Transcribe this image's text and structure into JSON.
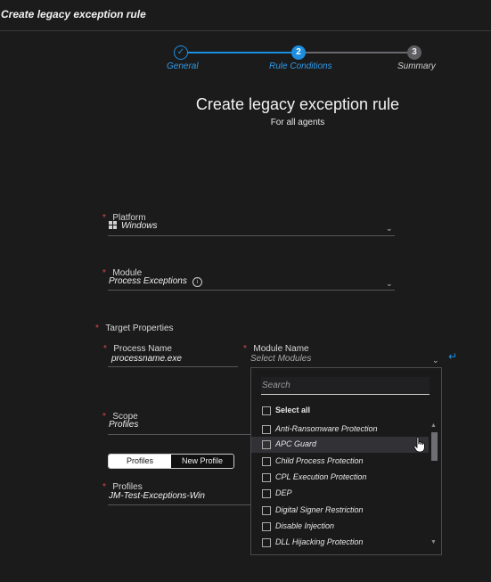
{
  "header": {
    "title": "Create legacy exception rule"
  },
  "stepper": {
    "steps": [
      {
        "number": "✓",
        "label": "General",
        "state": "done"
      },
      {
        "number": "2",
        "label": "Rule Conditions",
        "state": "active"
      },
      {
        "number": "3",
        "label": "Summary",
        "state": "pending"
      }
    ]
  },
  "page": {
    "title": "Create legacy exception rule",
    "subtitle": "For all agents"
  },
  "form": {
    "required_mark": "*",
    "platform": {
      "label": "Platform",
      "value": "Windows"
    },
    "module": {
      "label": "Module",
      "value": "Process Exceptions",
      "info_icon": "info-icon"
    },
    "target_properties": {
      "label": "Target Properties"
    },
    "process_name": {
      "label": "Process Name",
      "value": "processname.exe"
    },
    "module_name": {
      "label": "Module Name",
      "placeholder": "Select Modules",
      "enter_icon": "↵"
    },
    "scope": {
      "label": "Scope",
      "value": "Profiles"
    },
    "scope_toggle": {
      "options": [
        "Profiles",
        "New Profile"
      ],
      "selected": "Profiles"
    },
    "profiles": {
      "label": "Profiles",
      "value": "JM-Test-Exceptions-Win"
    }
  },
  "module_dropdown": {
    "search_placeholder": "Search",
    "select_all": "Select all",
    "options": [
      "Anti-Ransomware Protection",
      "APC Guard",
      "Child Process Protection",
      "CPL Execution Protection",
      "DEP",
      "Digital Signer Restriction",
      "Disable Injection",
      "DLL Hijacking Protection"
    ],
    "hovered": "APC Guard"
  },
  "colors": {
    "accent": "#1e8fe0",
    "background": "#1b1b1c",
    "required": "#e04848"
  }
}
